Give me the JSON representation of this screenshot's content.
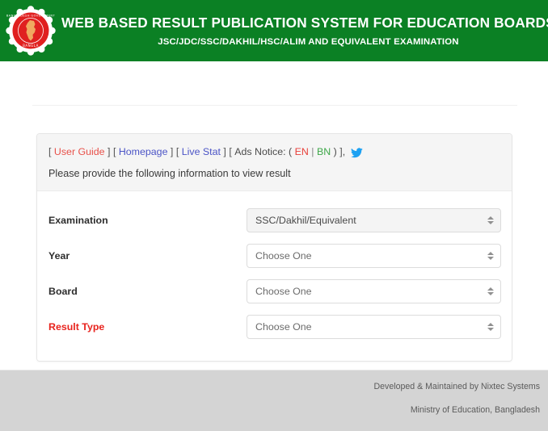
{
  "header": {
    "title_main": "WEB BASED RESULT PUBLICATION SYSTEM FOR EDUCATION BOARDS",
    "title_sub": "JSC/JDC/SSC/DAKHIL/HSC/ALIM AND EQUIVALENT EXAMINATION",
    "background_color": "#0b8024",
    "text_color": "#ffffff",
    "logo": {
      "name": "bangladesh-government-seal",
      "outer_color": "#ffffff",
      "ring_color": "#e02020",
      "map_color": "#f0a860"
    }
  },
  "card": {
    "links": {
      "open_bracket": "[",
      "close_bracket": "]",
      "user_guide": "User Guide",
      "homepage": "Homepage",
      "live_stat": "Live Stat",
      "ads_notice_label": "Ads Notice:",
      "paren_open": "(",
      "paren_close": ")",
      "en": "EN",
      "bn": "BN",
      "pipe": "|",
      "trailing_comma": ",",
      "twitter_icon": "twitter-bird-icon",
      "colors": {
        "user_guide": "#e8514a",
        "homepage": "#4b54c6",
        "live_stat": "#4b54c6",
        "en": "#e8403a",
        "bn": "#3fa84a",
        "twitter": "#1da1f2"
      }
    },
    "instruction": "Please provide the following information to view result",
    "form": {
      "rows": [
        {
          "label": "Examination",
          "required": false,
          "value": "SSC/Dakhil/Equivalent",
          "is_placeholder": false,
          "name": "examination"
        },
        {
          "label": "Year",
          "required": false,
          "value": "Choose One",
          "is_placeholder": true,
          "name": "year"
        },
        {
          "label": "Board",
          "required": false,
          "value": "Choose One",
          "is_placeholder": true,
          "name": "board"
        },
        {
          "label": "Result Type",
          "required": true,
          "value": "Choose One",
          "is_placeholder": true,
          "name": "result-type"
        }
      ]
    }
  },
  "footer": {
    "line1": "Developed & Maintained by Nixtec Systems",
    "line2": "Ministry of Education, Bangladesh",
    "background_color": "#d4d4d4",
    "text_color": "#5b5b5b"
  }
}
